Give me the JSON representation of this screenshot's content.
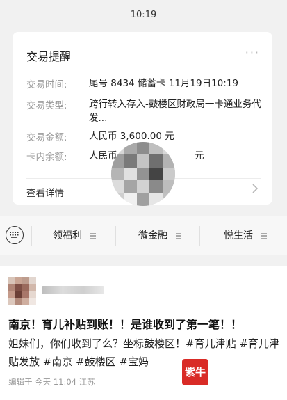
{
  "status_bar": {
    "time": "10:19"
  },
  "notice_card": {
    "title": "交易提醒",
    "more_icon": "ellipsis-icon",
    "rows": [
      {
        "label": "交易时间:",
        "value": "尾号 8434 储蓄卡 11月19日10:19"
      },
      {
        "label": "交易类型:",
        "value": "跨行转入存入-鼓楼区财政局一卡通业务代发..."
      },
      {
        "label": "交易金额:",
        "value": "人民币 3,600.00 元"
      },
      {
        "label": "卡内余额:",
        "value": "人民币"
      }
    ],
    "details_label": "查看详情",
    "balance_tail": "元"
  },
  "tabbar": {
    "keyboard_icon": "keyboard-icon",
    "items": [
      {
        "label": "领福利"
      },
      {
        "label": "微金融"
      },
      {
        "label": "悦生活"
      }
    ]
  },
  "post": {
    "headline": "南京！育儿补贴到账！！是谁收到了第一笔！！",
    "body": "姐妹们，你们收到了么？坐标鼓楼区！#育儿津贴 #育儿津贴发放 #南京 #鼓楼区 #宝妈",
    "meta": "编辑于 今天 11:04 江苏",
    "badge_text": "紫牛"
  },
  "colors": {
    "accent_red": "#d92b26",
    "muted_text": "#9a9a9a",
    "card_bg": "#ffffff",
    "page_bg": "#f1f1f1"
  }
}
